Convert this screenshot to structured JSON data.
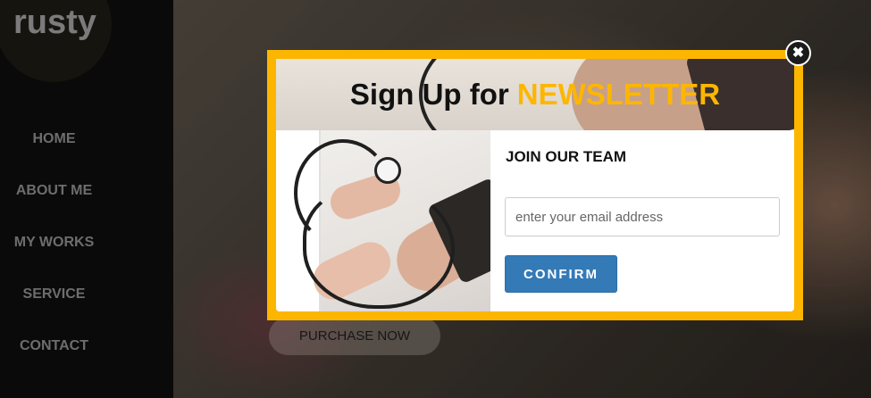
{
  "brand": {
    "logo_text": "rusty"
  },
  "sidebar": {
    "items": [
      {
        "label": "HOME"
      },
      {
        "label": "ABOUT ME"
      },
      {
        "label": "MY WORKS"
      },
      {
        "label": "SERVICE"
      },
      {
        "label": "CONTACT"
      }
    ]
  },
  "hero": {
    "purchase_label": "PURCHASE NOW"
  },
  "modal": {
    "title_prefix": "Sign Up for",
    "title_accent": "NEWSLETTER",
    "form_heading": "JOIN OUR TEAM",
    "email": {
      "value": "",
      "placeholder": "enter your email address"
    },
    "confirm_label": "CONFIRM",
    "close_icon": "close-icon",
    "image_subject": "blood pressure measurement"
  },
  "colors": {
    "accent": "#fdb600",
    "button_primary": "#337ab7",
    "sidebar_bg": "#0c0c0c"
  }
}
